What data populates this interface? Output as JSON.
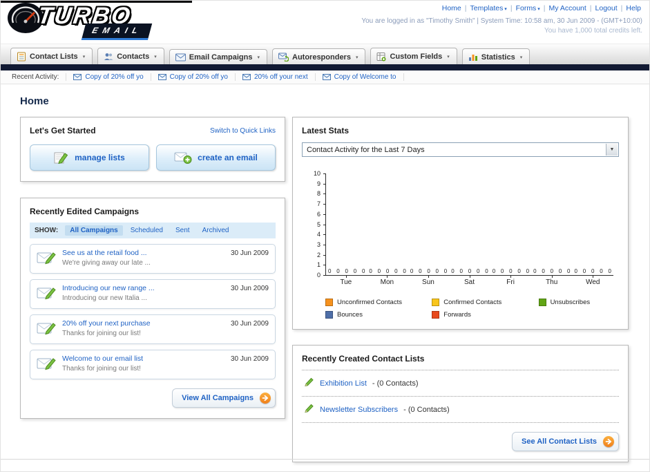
{
  "header": {
    "logo_title": "TURBO",
    "logo_subtitle": "EMAIL",
    "links": [
      {
        "label": "Home",
        "dropdown": false
      },
      {
        "label": "Templates",
        "dropdown": true
      },
      {
        "label": "Forms",
        "dropdown": true
      },
      {
        "label": "My Account",
        "dropdown": false
      },
      {
        "label": "Logout",
        "dropdown": false
      },
      {
        "label": "Help",
        "dropdown": false
      }
    ],
    "login_line": "You are logged in as \"Timothy Smith\" | System Time: 10:58 am, 30 Jun 2009 - (GMT+10:00)",
    "credits_line": "You have 1,000 total credits left."
  },
  "nav": {
    "tabs": [
      {
        "label": "Contact Lists",
        "icon": "contact-lists-icon"
      },
      {
        "label": "Contacts",
        "icon": "contacts-icon"
      },
      {
        "label": "Email Campaigns",
        "icon": "email-campaigns-icon"
      },
      {
        "label": "Autoresponders",
        "icon": "autoresponders-icon"
      },
      {
        "label": "Custom Fields",
        "icon": "custom-fields-icon"
      },
      {
        "label": "Statistics",
        "icon": "statistics-icon"
      }
    ]
  },
  "recent_activity": {
    "label": "Recent Activity:",
    "items": [
      {
        "label": "Copy of 20% off yo"
      },
      {
        "label": "Copy of 20% off yo"
      },
      {
        "label": "20% off your next"
      },
      {
        "label": "Copy of Welcome to"
      }
    ]
  },
  "page": {
    "title": "Home"
  },
  "get_started": {
    "title": "Let's Get Started",
    "switch_link": "Switch to Quick Links",
    "buttons": [
      {
        "label": "manage lists",
        "icon": "manage-lists-icon"
      },
      {
        "label": "create an email",
        "icon": "create-email-icon"
      }
    ]
  },
  "campaigns": {
    "title": "Recently Edited Campaigns",
    "show_label": "SHOW:",
    "filters": [
      {
        "label": "All Campaigns",
        "active": true
      },
      {
        "label": "Scheduled",
        "active": false
      },
      {
        "label": "Sent",
        "active": false
      },
      {
        "label": "Archived",
        "active": false
      }
    ],
    "items": [
      {
        "title": "See us at the retail food ...",
        "subtitle": "We're giving away our late ...",
        "date": "30 Jun 2009"
      },
      {
        "title": "Introducing our new range ...",
        "subtitle": "Introducing our new Italia ...",
        "date": "30 Jun 2009"
      },
      {
        "title": "20% off your next purchase",
        "subtitle": "Thanks for joining our list!",
        "date": "30 Jun 2009"
      },
      {
        "title": "Welcome to our email list",
        "subtitle": "Thanks for joining our list!",
        "date": "30 Jun 2009"
      }
    ],
    "view_all_label": "View All Campaigns"
  },
  "stats": {
    "title": "Latest Stats",
    "period_selector_value": "Contact Activity for the Last 7 Days"
  },
  "chart_data": {
    "type": "bar",
    "title": "Contact Activity for the Last 7 Days",
    "categories": [
      "Tue",
      "Mon",
      "Sun",
      "Sat",
      "Fri",
      "Thu",
      "Wed"
    ],
    "series": [
      {
        "name": "Unconfirmed Contacts",
        "color": "#f6921e",
        "values": [
          0,
          0,
          0,
          0,
          0,
          0,
          0
        ]
      },
      {
        "name": "Confirmed Contacts",
        "color": "#f8c51c",
        "values": [
          0,
          0,
          0,
          0,
          0,
          0,
          0
        ]
      },
      {
        "name": "Unsubscribes",
        "color": "#61a515",
        "values": [
          0,
          0,
          0,
          0,
          0,
          0,
          0
        ]
      },
      {
        "name": "Bounces",
        "color": "#4f6fa8",
        "values": [
          0,
          0,
          0,
          0,
          0,
          0,
          0
        ]
      },
      {
        "name": "Forwards",
        "color": "#e8491d",
        "values": [
          0,
          0,
          0,
          0,
          0,
          0,
          0
        ]
      }
    ],
    "ylim": [
      0,
      10
    ],
    "ytick_step": 1,
    "show_value_labels": true,
    "grid": false,
    "legend_position": "bottom"
  },
  "contact_lists": {
    "title": "Recently Created Contact Lists",
    "items": [
      {
        "name": "Exhibition List",
        "suffix": "- (0 Contacts)"
      },
      {
        "name": "Newsletter Subscribers",
        "suffix": "- (0 Contacts)"
      }
    ],
    "see_all_label": "See All Contact Lists"
  }
}
